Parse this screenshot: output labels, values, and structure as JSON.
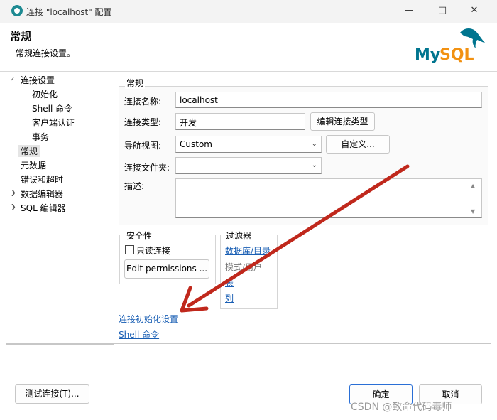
{
  "window": {
    "title": "连接 \"localhost\" 配置",
    "minimize_icon": "minimize-icon",
    "maximize_icon": "maximize-icon",
    "close_icon": "close-icon"
  },
  "header": {
    "title": "常规",
    "subtitle": "常规连接设置。",
    "logo_text": "MySQL",
    "logo_colors": {
      "my": "#00758f",
      "sql": "#f29111"
    }
  },
  "sidebar": {
    "items": [
      {
        "label": "连接设置",
        "expanded": true
      },
      {
        "label": "初始化"
      },
      {
        "label": "Shell 命令"
      },
      {
        "label": "客户端认证"
      },
      {
        "label": "事务"
      },
      {
        "label": "常规",
        "selected": true
      },
      {
        "label": "元数据"
      },
      {
        "label": "错误和超时"
      },
      {
        "label": "数据编辑器",
        "expanded": false
      },
      {
        "label": "SQL 编辑器",
        "expanded": false
      }
    ]
  },
  "general": {
    "group_title": "常规",
    "name_label": "连接名称:",
    "name_value": "localhost",
    "type_label": "连接类型:",
    "type_value": "开发",
    "edit_type_button": "编辑连接类型",
    "nav_label": "导航视图:",
    "nav_value": "Custom",
    "custom_button": "自定义...",
    "folder_label": "连接文件夹:",
    "folder_value": "",
    "desc_label": "描述:",
    "desc_value": ""
  },
  "security": {
    "title": "安全性",
    "readonly_label": "只读连接",
    "readonly_checked": false,
    "edit_permissions_button": "Edit permissions ..."
  },
  "filters": {
    "title": "过滤器",
    "links": [
      "数据库/目录",
      "模式/用户",
      "表",
      "列"
    ]
  },
  "links": {
    "init_settings": "连接初始化设置",
    "shell_commands": "Shell 命令"
  },
  "footer": {
    "test_button": "测试连接(T)...",
    "ok_button": "确定",
    "cancel_button": "取消"
  },
  "annotation": {
    "arrow_color": "#c0281c"
  },
  "watermark": "CSDN @致命代码毒师"
}
